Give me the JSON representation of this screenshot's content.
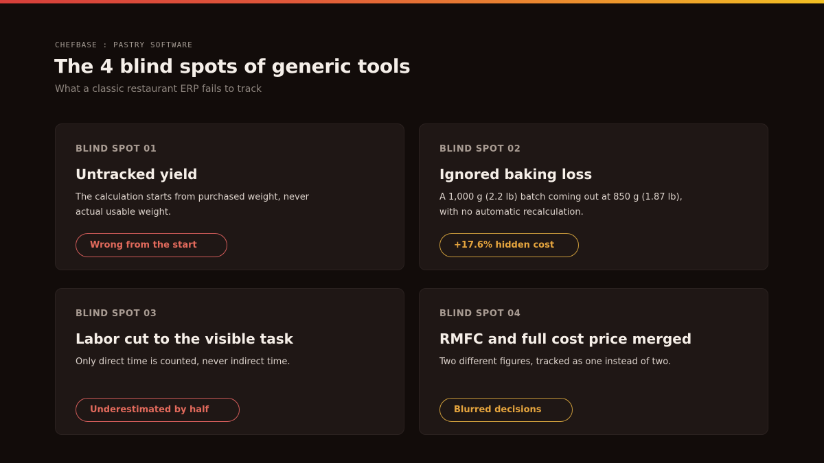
{
  "header": {
    "eyebrow": "CHEFBASE : PASTRY SOFTWARE",
    "title": "The 4 blind spots of generic tools",
    "subtitle": "What a classic restaurant ERP fails to track"
  },
  "cards": [
    {
      "label": "BLIND SPOT 01",
      "title": "Untracked yield",
      "description": "The calculation starts from purchased weight, never actual usable weight.",
      "badge": "Wrong from the start",
      "badge_color": "#e26a5c"
    },
    {
      "label": "BLIND SPOT 02",
      "title": "Ignored baking loss",
      "description": "A 1,000 g (2.2 lb) batch coming out at 850 g (1.87 lb), with no automatic recalculation.",
      "badge": "+17.6% hidden cost",
      "badge_color": "#e6a53e"
    },
    {
      "label": "BLIND SPOT 03",
      "title": "Labor cut to the visible task",
      "description": "Only direct time is counted, never indirect time.",
      "badge": "Underestimated by half",
      "badge_color": "#e26a5c"
    },
    {
      "label": "BLIND SPOT 04",
      "title": "RMFC and full cost price merged",
      "description": "Two different figures, tracked as one instead of two.",
      "badge": "Blurred decisions",
      "badge_color": "#e6a53e"
    }
  ],
  "colors": {
    "background": "#120c0a",
    "card": "#1f1715",
    "accent_red": "#e26a5c",
    "accent_gold": "#e6a53e",
    "gradient_start": "#d63f3a",
    "gradient_end": "#f2c023"
  }
}
